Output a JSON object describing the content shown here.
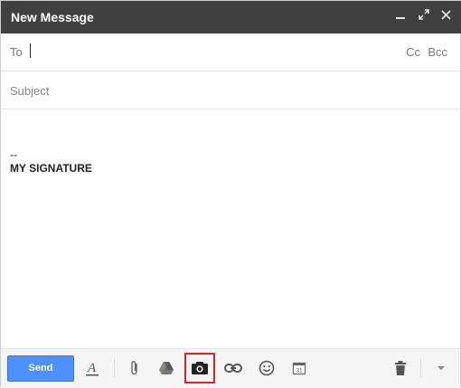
{
  "window": {
    "title": "New Message",
    "controls": [
      "minimize-icon",
      "popout-icon",
      "close-icon"
    ]
  },
  "recipients": {
    "to_label": "To",
    "to_value": "",
    "cc_label": "Cc",
    "bcc_label": "Bcc"
  },
  "subject": {
    "placeholder": "Subject",
    "value": ""
  },
  "body": {
    "signature_separator": "--",
    "signature_text": "MY SIGNATURE"
  },
  "toolbar": {
    "send_label": "Send",
    "icons": [
      "formatting-options-icon",
      "attach-files-icon",
      "insert-from-drive-icon",
      "insert-photo-icon",
      "insert-link-icon",
      "insert-emoticon-icon",
      "insert-invitation-icon",
      "discard-draft-icon",
      "more-options-icon"
    ],
    "highlighted_icon": "insert-photo-icon",
    "highlight_color": "#d8262b",
    "send_color": "#4d90fe",
    "titlebar_color": "#404040",
    "calendar_day": "31"
  }
}
